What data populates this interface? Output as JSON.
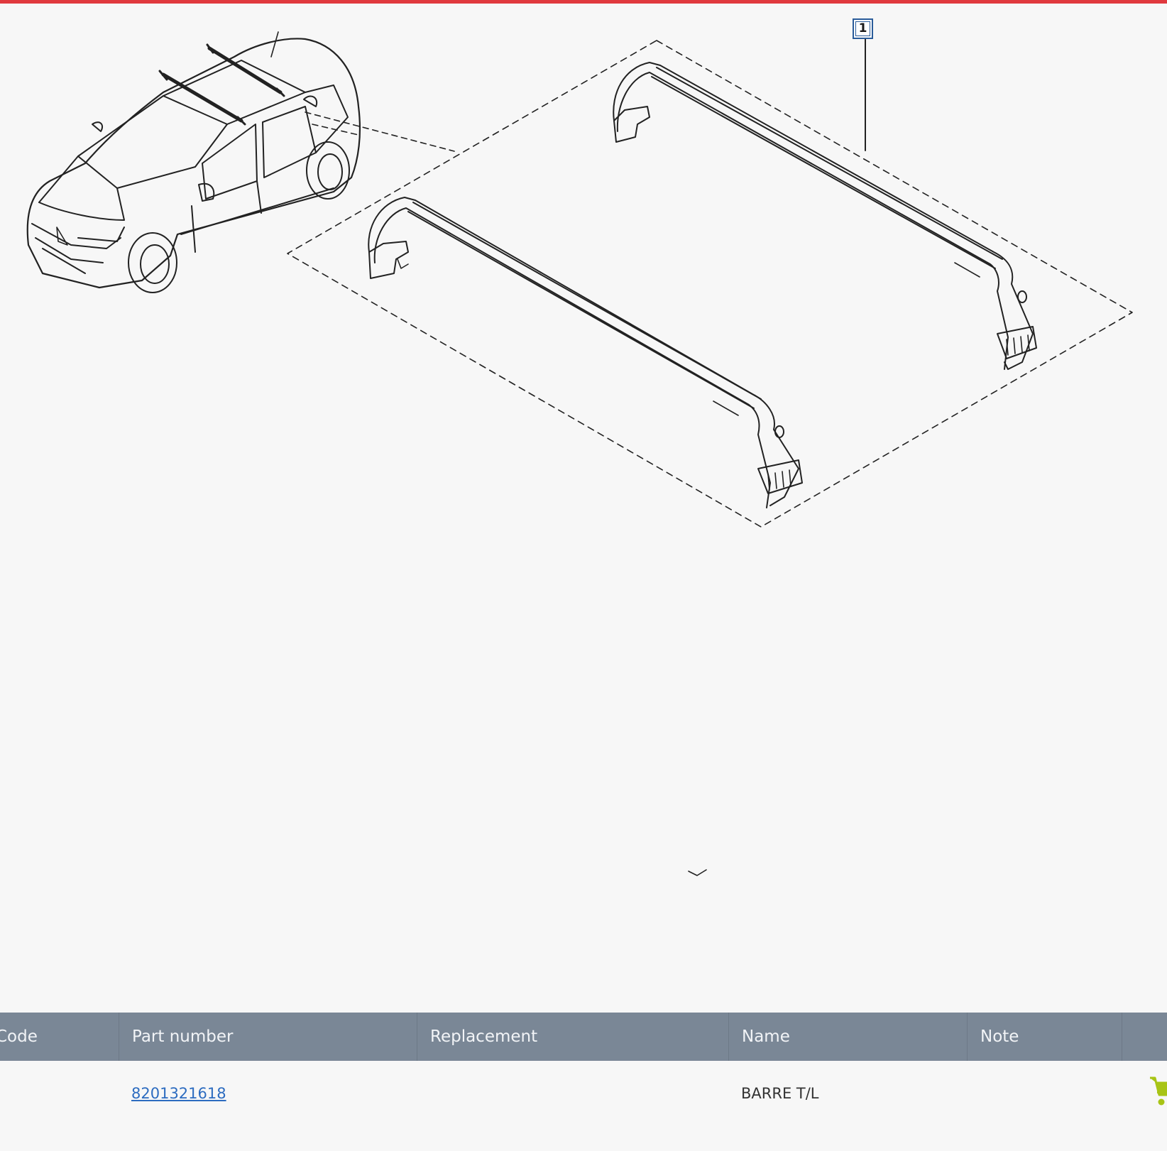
{
  "diagram": {
    "callouts": [
      {
        "label": "1"
      }
    ]
  },
  "parts_table": {
    "columns": [
      {
        "key": "code",
        "label": "Code"
      },
      {
        "key": "part_number",
        "label": "Part number"
      },
      {
        "key": "replacement",
        "label": "Replacement"
      },
      {
        "key": "name",
        "label": "Name"
      },
      {
        "key": "note",
        "label": "Note"
      },
      {
        "key": "cart",
        "label": ""
      }
    ],
    "rows": [
      {
        "code": "",
        "part_number": "8201321618",
        "replacement": "",
        "name": "BARRE T/L",
        "note": "",
        "cart_icon": "shopping-cart-icon"
      }
    ]
  },
  "colors": {
    "accent_bar": "#e0393e",
    "header_bg": "#7a8796",
    "link": "#2d6cc0",
    "cart_icon": "#a8c416",
    "callout_border": "#2a5c9a"
  }
}
